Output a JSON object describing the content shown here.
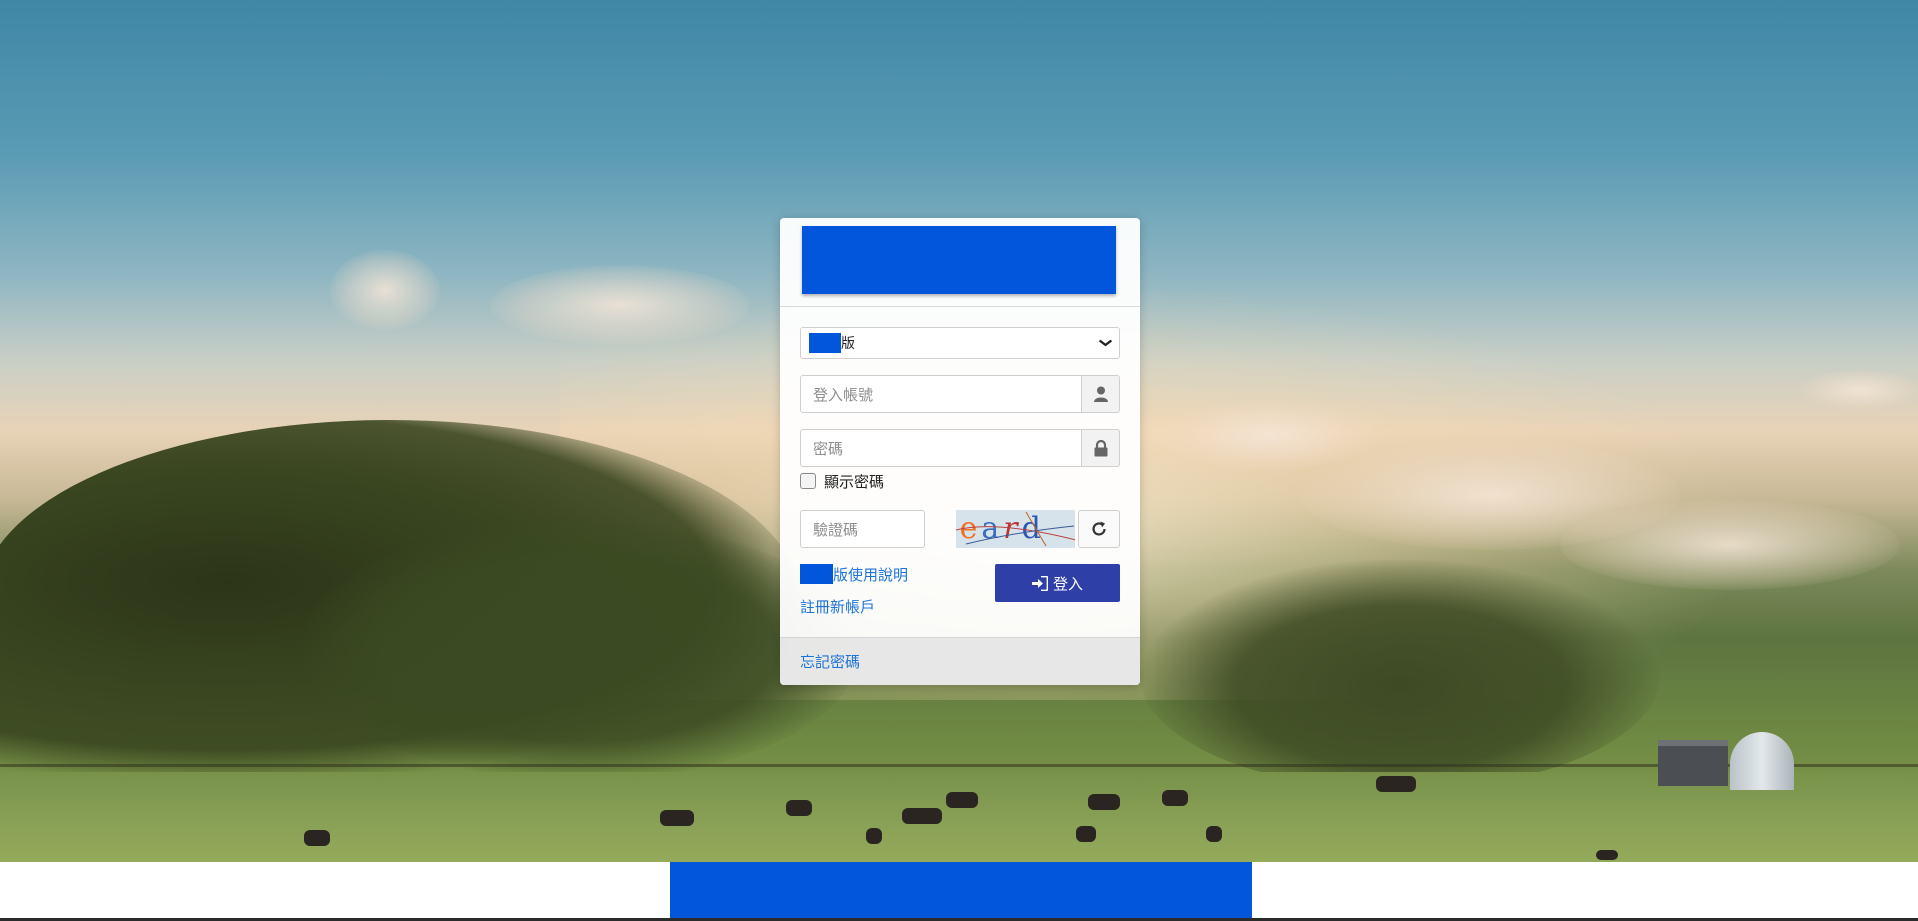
{
  "version_select": {
    "selected_suffix": "版"
  },
  "login": {
    "account_placeholder": "登入帳號",
    "account_icon": "user-icon",
    "password_placeholder": "密碼",
    "password_icon": "lock-icon",
    "show_password_label": "顯示密碼",
    "captcha_placeholder": "驗證碼",
    "captcha_text": [
      "e",
      "a",
      "r",
      "d"
    ],
    "refresh_icon": "refresh-icon",
    "submit_label": "登入",
    "submit_icon": "sign-in-icon"
  },
  "links": {
    "manual_suffix": "版使用說明",
    "register": "註冊新帳戶",
    "forgot_password": "忘記密碼"
  },
  "colors": {
    "brand_redaction": "#0256db",
    "login_button": "#2e3fa8",
    "link": "#1e73d8"
  }
}
